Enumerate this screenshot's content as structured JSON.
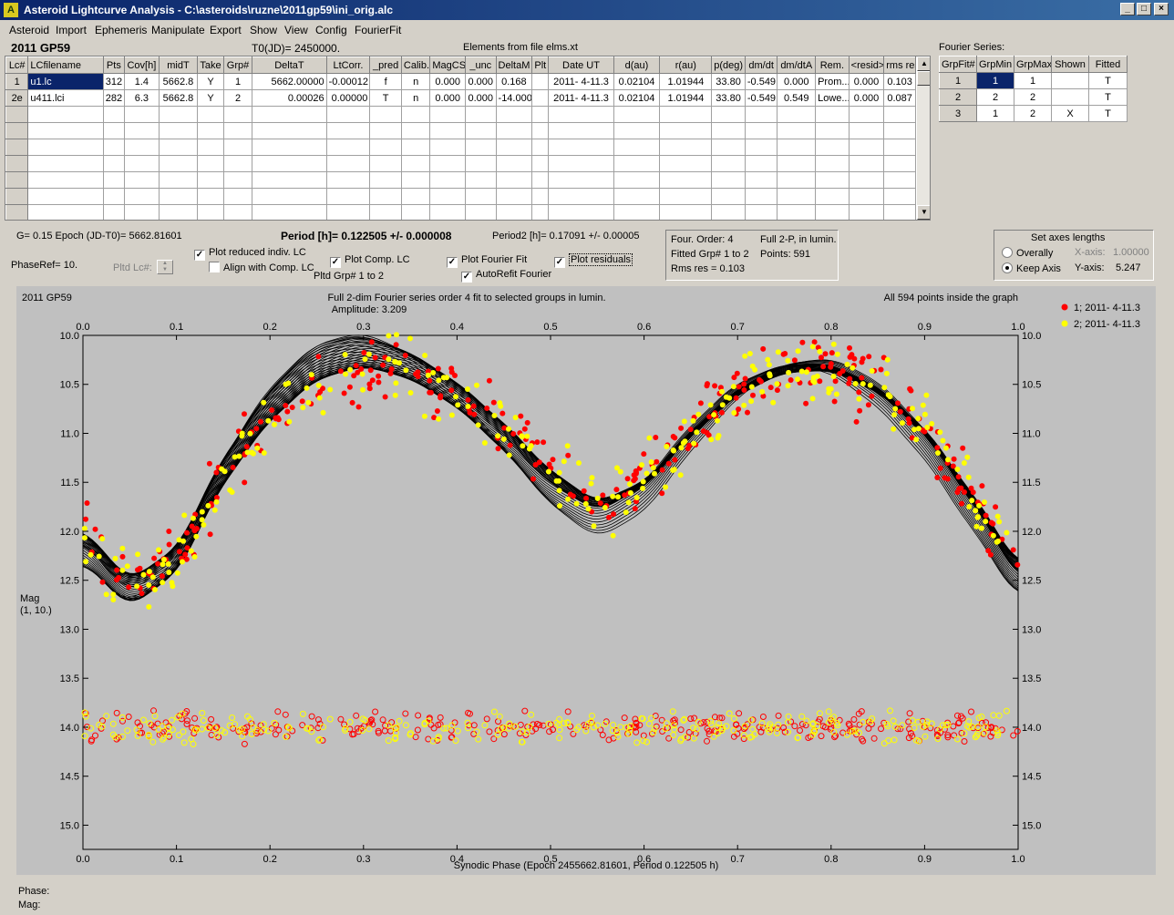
{
  "window": {
    "title": "Asteroid Lightcurve Analysis - C:\\asteroids\\ruzne\\2011gp59\\ini_orig.alc",
    "buttons": [
      "_",
      "□",
      "×"
    ]
  },
  "menu": [
    "Asteroid",
    "Import",
    "Ephemeris",
    "Manipulate",
    "Export",
    "Show",
    "View",
    "Config",
    "FourierFit"
  ],
  "header": {
    "object_name": "2011 GP59",
    "t0": "T0(JD)= 2450000.",
    "elements_source": "Elements from file elms.xt",
    "fourier_series_label": "Fourier Series:"
  },
  "lc_table": {
    "columns": [
      "Lc#",
      "LCfilename",
      "Pts",
      "Cov[h]",
      "midT",
      "Take",
      "Grp#",
      "DeltaT",
      "LtCorr.",
      "_pred",
      "Calib.",
      "MagCS",
      "_unc",
      "DeltaM",
      "Plt",
      "Date UT",
      "d(au)",
      "r(au)",
      "p(deg)",
      "dm/dt",
      "dm/dtA",
      "Rem.",
      "<resid>",
      "rms res"
    ],
    "rows": [
      [
        "1",
        "u1.lc",
        "312",
        "1.4",
        "5662.8",
        "Y",
        "1",
        "5662.00000",
        "-0.00012",
        "f",
        "n",
        "0.000",
        "0.000",
        "0.168",
        "",
        "2011- 4-11.3",
        "0.02104",
        "1.01944",
        "33.80",
        "-0.549",
        "0.000",
        "Prom...",
        "0.000",
        "0.103"
      ],
      [
        "2e",
        "u411.lci",
        "282",
        "6.3",
        "5662.8",
        "Y",
        "2",
        "0.00026",
        "0.00000",
        "T",
        "n",
        "0.000",
        "0.000",
        "-14.000",
        "",
        "2011- 4-11.3",
        "0.02104",
        "1.01944",
        "33.80",
        "-0.549",
        "0.549",
        "Lowe...",
        "0.000",
        "0.087"
      ]
    ]
  },
  "fourier_table": {
    "columns": [
      "GrpFit#",
      "GrpMin",
      "GrpMax",
      "Shown",
      "Fitted"
    ],
    "rows": [
      [
        "1",
        "1",
        "1",
        "",
        "T"
      ],
      [
        "2",
        "2",
        "2",
        "",
        "T"
      ],
      [
        "3",
        "1",
        "2",
        "X",
        "T"
      ]
    ]
  },
  "info": {
    "g_epoch": "G= 0.15   Epoch (JD-T0)= 5662.81601",
    "period": "Period [h]= 0.122505 +/- 0.000008",
    "period2": "Period2 [h]= 0.17091 +/- 0.00005",
    "phaseref": "PhaseRef= 10.",
    "pltd_lc": "Pltd Lc#:",
    "pltd_grp": "Pltd Grp#  1   to   2"
  },
  "checkboxes": {
    "plot_reduced": {
      "label": "Plot reduced indiv. LC",
      "checked": "✓"
    },
    "align_comp": {
      "label": "Align with Comp. LC",
      "checked": ""
    },
    "plot_comp": {
      "label": "Plot Comp. LC",
      "checked": "✓"
    },
    "plot_fourier": {
      "label": "Plot Fourier Fit",
      "checked": "✓"
    },
    "autorefit": {
      "label": "AutoRefit Fourier",
      "checked": "✓"
    },
    "plot_residuals": {
      "label": "Plot residuals",
      "checked": "✓"
    }
  },
  "fit_box": {
    "order": "Four. Order:  4",
    "full": "Full 2-P, in lumin.",
    "fitted": "Fitted Grp# 1 to 2",
    "points": "Points: 591",
    "rms": "Rms res     = 0.103"
  },
  "axes_box": {
    "title": "Set axes lengths",
    "overally": "Overally",
    "keep_axis": "Keep Axis",
    "x_axis_label": "X-axis:",
    "x_axis_value": "1.00000",
    "y_axis_label": "Y-axis:",
    "y_axis_value": "5.247"
  },
  "plot": {
    "object": "2011 GP59",
    "title": "Full 2-dim Fourier series order 4 fit to selected groups in lumin.",
    "amplitude": "Amplitude: 3.209",
    "points_note": "All 594 points inside the graph",
    "ylabel_line1": "Mag",
    "ylabel_line2": "(1, 10.)",
    "xlabel": "Synodic Phase (Epoch 2455662.81601, Period 0.122505 h)",
    "legend": [
      {
        "label": "1; 2011- 4-11.3",
        "color": "#ff0000"
      },
      {
        "label": "2; 2011- 4-11.3",
        "color": "#ffff00"
      }
    ]
  },
  "chart_data": {
    "type": "scatter",
    "title": "Full 2-dim Fourier series order 4 fit to selected groups in lumin.",
    "xlabel": "Synodic Phase (Epoch 2455662.81601, Period 0.122505 h)",
    "ylabel": "Mag (1, 10.)",
    "xlim": [
      0.0,
      1.0
    ],
    "ylim": [
      15.247,
      10.0
    ],
    "x_ticks": [
      "0.0",
      "0.1",
      "0.2",
      "0.3",
      "0.4",
      "0.5",
      "0.6",
      "0.7",
      "0.8",
      "0.9",
      "1.0"
    ],
    "y_ticks": [
      "10.0",
      "10.5",
      "11.0",
      "11.5",
      "12.0",
      "12.5",
      "13.0",
      "13.5",
      "14.0",
      "14.5",
      "15.0"
    ],
    "grid": false,
    "legend_position": "top-right",
    "fourier_curve_mean": {
      "x": [
        0.0,
        0.05,
        0.1,
        0.15,
        0.2,
        0.25,
        0.3,
        0.35,
        0.4,
        0.45,
        0.5,
        0.55,
        0.6,
        0.65,
        0.7,
        0.75,
        0.8,
        0.85,
        0.9,
        0.95,
        1.0
      ],
      "y": [
        12.0,
        12.55,
        12.3,
        11.45,
        10.85,
        10.45,
        10.3,
        10.38,
        10.6,
        10.95,
        11.4,
        11.7,
        11.5,
        11.0,
        10.6,
        10.38,
        10.35,
        10.55,
        10.95,
        11.6,
        12.35
      ]
    },
    "series": [
      {
        "name": "1; 2011- 4-11.3",
        "color": "#ff0000",
        "residual_offset": 14.0
      },
      {
        "name": "2; 2011- 4-11.3",
        "color": "#ffff00",
        "residual_offset": 14.0
      }
    ]
  },
  "status": {
    "phase": "Phase:",
    "mag": "Mag:"
  }
}
